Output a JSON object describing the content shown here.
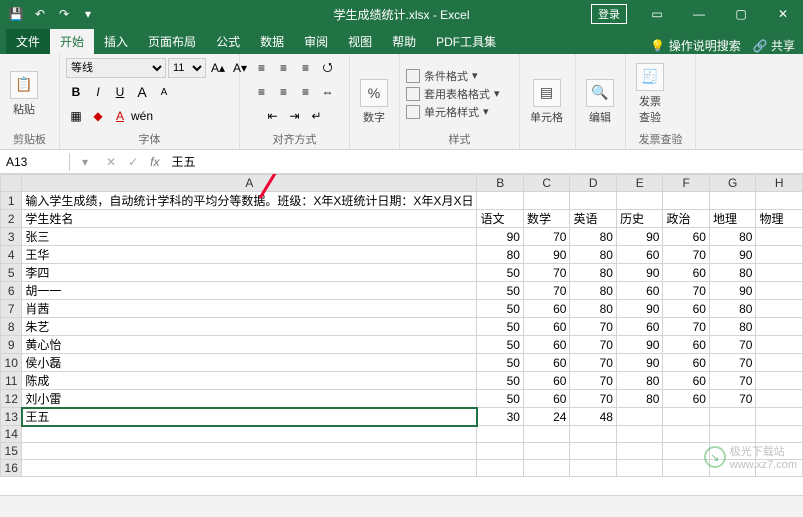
{
  "title_file": "学生成绩统计.xlsx",
  "title_app": "Excel",
  "login": "登录",
  "tabs": {
    "file": "文件",
    "home": "开始",
    "insert": "插入",
    "layout": "页面布局",
    "formula": "公式",
    "data": "数据",
    "review": "审阅",
    "view": "视图",
    "help": "帮助",
    "pdf": "PDF工具集",
    "tell": "操作说明搜索",
    "share": "共享"
  },
  "ribbon": {
    "clipboard": {
      "paste": "粘贴",
      "label": "剪贴板"
    },
    "font": {
      "name": "等线",
      "size": "11",
      "label": "字体",
      "wen": "wén"
    },
    "align": {
      "label": "对齐方式"
    },
    "number": {
      "label": "数字"
    },
    "styles": {
      "cond": "条件格式",
      "tbl": "套用表格格式",
      "cell": "单元格样式",
      "label": "样式"
    },
    "cells": {
      "label": "单元格"
    },
    "edit": {
      "label": "编辑"
    },
    "invoice": {
      "btn": "发票\n查验",
      "label": "发票查验"
    }
  },
  "namebox": {
    "ref": "A13",
    "value": "王五"
  },
  "columns": [
    "A",
    "B",
    "C",
    "D",
    "E",
    "F",
    "G",
    "H"
  ],
  "rows_header": [
    "1",
    "2",
    "3",
    "4",
    "5",
    "6",
    "7",
    "8",
    "9",
    "10",
    "11",
    "12",
    "13",
    "14",
    "15",
    "16"
  ],
  "cell_title": "输入学生成绩，自动统计学科的平均分等数据。班级：X年X班统计日期：X年X月X日",
  "headers": [
    "学生姓名",
    "语文",
    "数学",
    "英语",
    "历史",
    "政治",
    "地理",
    "物理"
  ],
  "students": [
    {
      "name": "张三",
      "s": [
        90,
        70,
        80,
        90,
        60,
        80
      ]
    },
    {
      "name": "王华",
      "s": [
        80,
        90,
        80,
        60,
        70,
        90
      ]
    },
    {
      "name": "李四",
      "s": [
        50,
        70,
        80,
        90,
        60,
        80
      ]
    },
    {
      "name": "胡一一",
      "s": [
        50,
        70,
        80,
        60,
        70,
        90
      ]
    },
    {
      "name": "肖茜",
      "s": [
        50,
        60,
        80,
        90,
        60,
        80
      ]
    },
    {
      "name": "朱艺",
      "s": [
        50,
        60,
        70,
        60,
        70,
        80
      ]
    },
    {
      "name": "黄心怡",
      "s": [
        50,
        60,
        70,
        90,
        60,
        70
      ]
    },
    {
      "name": "侯小磊",
      "s": [
        50,
        60,
        70,
        90,
        60,
        70
      ]
    },
    {
      "name": "陈成",
      "s": [
        50,
        60,
        70,
        80,
        60,
        70
      ]
    },
    {
      "name": "刘小雷",
      "s": [
        50,
        60,
        70,
        80,
        60,
        70
      ]
    },
    {
      "name": "王五",
      "s": [
        30,
        24,
        48,
        null,
        null,
        null
      ]
    }
  ],
  "selected": "A13",
  "watermark": {
    "brand": "极光下载站",
    "url": "www.xz7.com"
  }
}
